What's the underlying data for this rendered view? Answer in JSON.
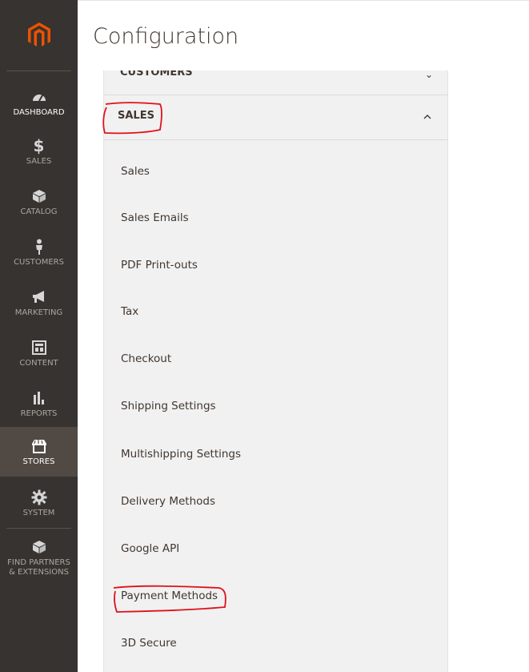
{
  "header": {
    "title": "Configuration"
  },
  "nav": {
    "logo_icon": "magento-logo-icon",
    "items": [
      {
        "id": "dashboard",
        "label": "DASHBOARD",
        "icon": "dashboard-gauge-icon"
      },
      {
        "id": "sales",
        "label": "SALES",
        "icon": "dollar-icon"
      },
      {
        "id": "catalog",
        "label": "CATALOG",
        "icon": "cube-icon"
      },
      {
        "id": "customers",
        "label": "CUSTOMERS",
        "icon": "person-icon"
      },
      {
        "id": "marketing",
        "label": "MARKETING",
        "icon": "megaphone-icon"
      },
      {
        "id": "content",
        "label": "CONTENT",
        "icon": "layout-icon"
      },
      {
        "id": "reports",
        "label": "REPORTS",
        "icon": "bar-chart-icon"
      },
      {
        "id": "stores",
        "label": "STORES",
        "icon": "storefront-icon"
      },
      {
        "id": "system",
        "label": "SYSTEM",
        "icon": "gear-icon"
      },
      {
        "id": "partners",
        "label_line1": "FIND PARTNERS",
        "label_line2": "& EXTENSIONS",
        "icon": "box-icon"
      }
    ],
    "active": "stores"
  },
  "config": {
    "prev_section": {
      "label": "CUSTOMERS",
      "icon": "chevron-down-icon"
    },
    "section": {
      "label": "SALES",
      "icon": "chevron-up-icon",
      "expanded": true
    },
    "items": [
      "Sales",
      "Sales Emails",
      "PDF Print-outs",
      "Tax",
      "Checkout",
      "Shipping Settings",
      "Multishipping Settings",
      "Delivery Methods",
      "Google API",
      "Payment Methods",
      "3D Secure"
    ]
  },
  "colors": {
    "nav_bg": "#373330",
    "nav_active": "#514943",
    "logo_orange": "#eb5202",
    "panel_bg": "#f1f1f1",
    "text": "#41362f",
    "annotation_red": "#e0101a"
  }
}
